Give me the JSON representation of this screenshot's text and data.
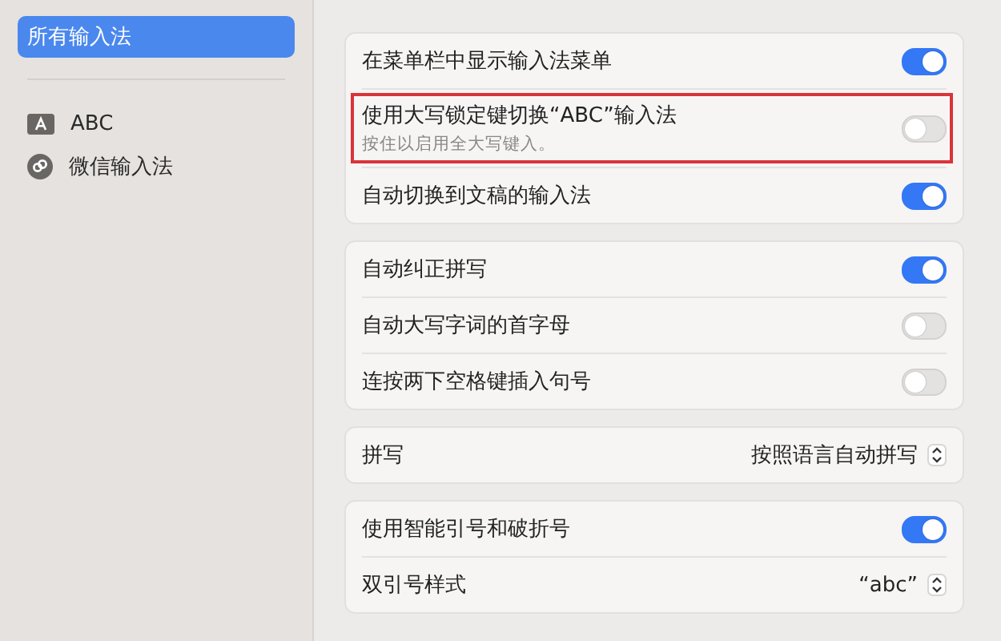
{
  "sidebar": {
    "items": [
      {
        "label": "所有输入法",
        "selected": true,
        "kind": "plain"
      },
      {
        "label": "ABC",
        "selected": false,
        "kind": "abc"
      },
      {
        "label": "微信输入法",
        "selected": false,
        "kind": "wechat"
      }
    ]
  },
  "groups": [
    {
      "rows": [
        {
          "kind": "toggle",
          "label": "在菜单栏中显示输入法菜单",
          "on": true,
          "highlighted": false
        },
        {
          "kind": "toggle",
          "label": "使用大写锁定键切换“ABC”输入法",
          "hint": "按住以启用全大写键入。",
          "on": false,
          "highlighted": true
        },
        {
          "kind": "toggle",
          "label": "自动切换到文稿的输入法",
          "on": true,
          "highlighted": false
        }
      ]
    },
    {
      "rows": [
        {
          "kind": "toggle",
          "label": "自动纠正拼写",
          "on": true,
          "highlighted": false
        },
        {
          "kind": "toggle",
          "label": "自动大写字词的首字母",
          "on": false,
          "highlighted": false
        },
        {
          "kind": "toggle",
          "label": "连按两下空格键插入句号",
          "on": false,
          "highlighted": false
        }
      ]
    },
    {
      "rows": [
        {
          "kind": "select",
          "label": "拼写",
          "value": "按照语言自动拼写",
          "highlighted": false
        }
      ]
    },
    {
      "rows": [
        {
          "kind": "toggle",
          "label": "使用智能引号和破折号",
          "on": true,
          "highlighted": false
        },
        {
          "kind": "select",
          "label": "双引号样式",
          "value": "“abc”",
          "highlighted": false
        }
      ]
    }
  ]
}
